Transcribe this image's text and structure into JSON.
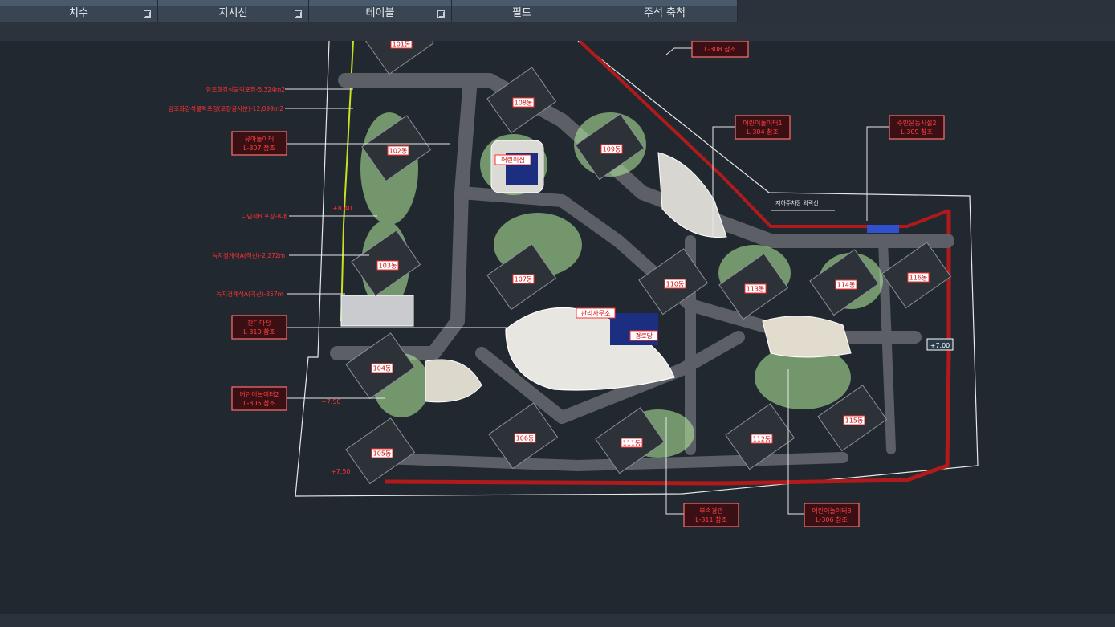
{
  "ribbon": {
    "panels": [
      {
        "label": "치수",
        "has_launcher": true
      },
      {
        "label": "지시선",
        "has_launcher": true
      },
      {
        "label": "테이블",
        "has_launcher": true
      },
      {
        "label": "필드",
        "has_launcher": false
      },
      {
        "label": "주석 축척",
        "has_launcher": false
      }
    ]
  },
  "drawing": {
    "buildings": [
      "101동",
      "102동",
      "103동",
      "104동",
      "105동",
      "106동",
      "107동",
      "108동",
      "109동",
      "110동",
      "111동",
      "112동",
      "113동",
      "114동",
      "115동",
      "116동"
    ],
    "callouts": [
      {
        "title": "유아놀이터",
        "ref": "L-307 참조"
      },
      {
        "title": "잔디마당",
        "ref": "L-310 참조"
      },
      {
        "title": "어린이놀이터2",
        "ref": "L-305 참조"
      },
      {
        "title": "어린이놀이터1",
        "ref": "L-304 참조"
      },
      {
        "title": "주민운동시설2",
        "ref": "L-309 참조"
      },
      {
        "title": "부속경관",
        "ref": "L-311 참조"
      },
      {
        "title": "어린이놀이터3",
        "ref": "L-306 참조"
      },
      {
        "title": "",
        "ref": "L-308 참조"
      }
    ],
    "notes": [
      "앙조화강석블럭포장-5,324m2",
      "앙조화강석블럭포장(포장공사분)-12,099m2",
      "디딤석B 포장-8개",
      "녹지경계석A(직선)-2,272m",
      "녹지경계석A(곡선)-357m"
    ],
    "facilities": [
      "어린이집",
      "관리사무소",
      "경로당",
      "지하주차장 외곽선"
    ],
    "levels": [
      "+8.40",
      "+7.50",
      "+7.50",
      "+7.00"
    ]
  },
  "colors": {
    "ribbon_tab": "#3a4554",
    "canvas_bg": "#212830",
    "label_red": "#ff3030",
    "landscape_green": "#b8f0a0",
    "path_gray": "#555a5f"
  }
}
